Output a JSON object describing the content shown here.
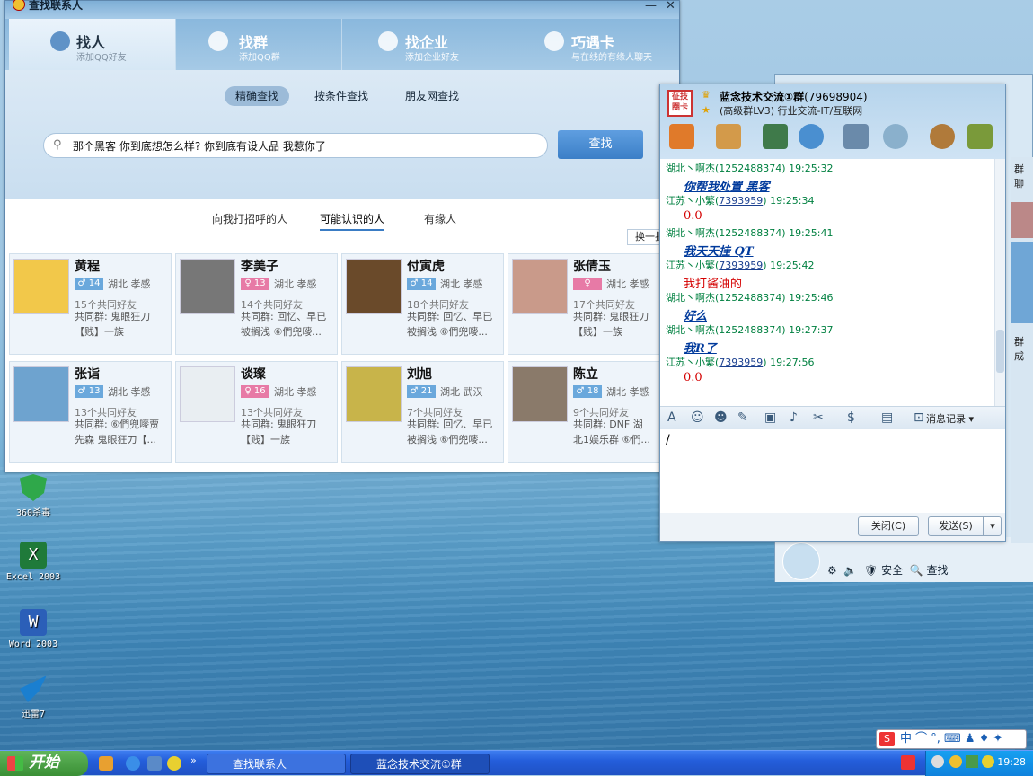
{
  "desktop": {
    "icons": [
      {
        "label": "360杀毒",
        "color": "#2fa84a"
      },
      {
        "label": "Excel 2003",
        "color": "#1f7a3a"
      },
      {
        "label": "Word 2003",
        "color": "#2b5fb8"
      },
      {
        "label": "迅雷7",
        "color": "#1a7fd0"
      }
    ]
  },
  "find_window": {
    "title": "查找联系人",
    "tabs": [
      {
        "label": "找人",
        "sub": "添加QQ好友"
      },
      {
        "label": "找群",
        "sub": "添加QQ群"
      },
      {
        "label": "找企业",
        "sub": "添加企业好友"
      },
      {
        "label": "巧遇卡",
        "sub": "与在线的有缘人聊天"
      }
    ],
    "modes": [
      "精确查找",
      "按条件查找",
      "朋友网查找"
    ],
    "search_value": "那个黑客 你到底想怎么样? 你到底有设人品 我惹你了",
    "search_button": "查找",
    "subtabs": [
      "向我打招呼的人",
      "可能认识的人",
      "有缘人"
    ],
    "refresh": "换一批",
    "people": [
      {
        "name": "黄程",
        "gender": "♂",
        "age": "14",
        "loc": "湖北 孝感",
        "friends": "15个共同好友",
        "groups": "共同群: 鬼眼狂刀",
        "extra": "【贱】一族",
        "avatar": "#f2c84a"
      },
      {
        "name": "李美子",
        "gender": "♀",
        "age": "13",
        "loc": "湖北 孝感",
        "friends": "14个共同好友",
        "groups": "共同群: 回忆、早已",
        "extra": "被搁浅 ⑥們兜嘜...",
        "avatar": "#777777"
      },
      {
        "name": "付寅虎",
        "gender": "♂",
        "age": "14",
        "loc": "湖北 孝感",
        "friends": "18个共同好友",
        "groups": "共同群: 回忆、早已",
        "extra": "被搁浅 ⑥們兜嘜...",
        "avatar": "#6a4a2a"
      },
      {
        "name": "张倩玉",
        "gender": "♀",
        "age": "",
        "loc": "湖北 孝感",
        "friends": "17个共同好友",
        "groups": "共同群: 鬼眼狂刀",
        "extra": "【贱】一族",
        "avatar": "#c99a8a"
      },
      {
        "name": "张诣",
        "gender": "♂",
        "age": "13",
        "loc": "湖北 孝感",
        "friends": "13个共同好友",
        "groups": "共同群: ⑥們兜嘜贾",
        "extra": "先森 鬼眼狂刀【...",
        "avatar": "#6ea3cf"
      },
      {
        "name": "谈璨",
        "gender": "♀",
        "age": "16",
        "loc": "湖北 孝感",
        "friends": "13个共同好友",
        "groups": "共同群: 鬼眼狂刀",
        "extra": "【贱】一族",
        "avatar": "#e9eef2"
      },
      {
        "name": "刘旭",
        "gender": "♂",
        "age": "21",
        "loc": "湖北 武汉",
        "friends": "7个共同好友",
        "groups": "共同群: 回忆、早已",
        "extra": "被搁浅 ⑥們兜嘜...",
        "avatar": "#c8b44a"
      },
      {
        "name": "陈立",
        "gender": "♂",
        "age": "18",
        "loc": "湖北 孝感",
        "friends": "9个共同好友",
        "groups": "共同群: DNF 湖",
        "extra": "北1娱乐群 ⑥們...",
        "avatar": "#8a7a6a"
      }
    ]
  },
  "chat_window": {
    "group_name": "蓝念技术交流①群",
    "group_id": "(79698904)",
    "group_sub": "(高级群LV3) 行业交流-IT/互联网",
    "messages": [
      {
        "kind": "h1",
        "text": "湖北丶啊杰(1252488374)  19:25:32"
      },
      {
        "kind": "bb",
        "text": "你帮我处置 黑客"
      },
      {
        "kind": "h2",
        "name": "江苏丶小繁(",
        "id": "7393959",
        "time": ")  19:25:34"
      },
      {
        "kind": "red",
        "text": "0.0"
      },
      {
        "kind": "h1",
        "text": "湖北丶啊杰(1252488374)  19:25:41"
      },
      {
        "kind": "bb",
        "text": "我天天挂 QT"
      },
      {
        "kind": "h2",
        "name": "江苏丶小繁(",
        "id": "7393959",
        "time": ")  19:25:42"
      },
      {
        "kind": "red",
        "text": "我打酱油的"
      },
      {
        "kind": "h1",
        "text": "湖北丶啊杰(1252488374)  19:25:46"
      },
      {
        "kind": "bb",
        "text": "好么"
      },
      {
        "kind": "h1",
        "text": "湖北丶啊杰(1252488374)  19:27:37"
      },
      {
        "kind": "bb",
        "text": "我R了"
      },
      {
        "kind": "h2",
        "name": "江苏丶小繁(",
        "id": "7393959",
        "time": ")  19:27:56"
      },
      {
        "kind": "red",
        "text": "0.0"
      }
    ],
    "history_label": "消息记录",
    "input_value": "/",
    "close_button": "关闭(C)",
    "send_button": "发送(S)"
  },
  "qq_main": {
    "bottom_items": [
      "安全",
      "查找"
    ],
    "side_labels": [
      "群聊",
      "群成"
    ]
  },
  "taskbar": {
    "start": "开始",
    "tasks": [
      "查找联系人",
      "蓝念技术交流①群"
    ],
    "time": "19:28"
  },
  "ime": {
    "text": "中 ⌒ °, ⌨ ♟ ♦ ✦"
  }
}
